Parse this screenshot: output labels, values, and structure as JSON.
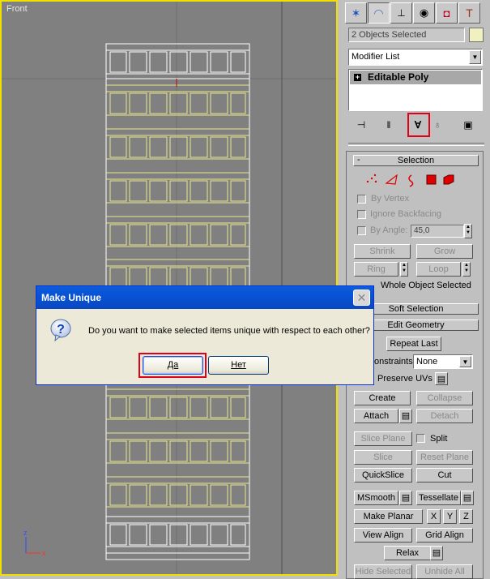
{
  "viewport": {
    "label": "Front"
  },
  "panel": {
    "tabs": [
      "create-icon",
      "modify-icon",
      "hierarchy-icon",
      "motion-icon",
      "display-icon",
      "utilities-icon"
    ],
    "selection_name": "2 Objects Selected",
    "modifier_list": "Modifier List",
    "stack_item": "Editable Poly",
    "selection_rollout": {
      "title": "Selection",
      "by_vertex": "By Vertex",
      "ignore_backfacing": "Ignore Backfacing",
      "by_angle": "By Angle:",
      "angle_value": "45,0",
      "shrink": "Shrink",
      "grow": "Grow",
      "ring": "Ring",
      "loop": "Loop",
      "whole_object": "Whole Object Selected"
    },
    "soft_selection": "Soft Selection",
    "edit_geometry": {
      "title": "Edit Geometry",
      "repeat_last": "Repeat Last",
      "constraints": "onstraints:",
      "constraints_value": "None",
      "preserve_uvs": "Preserve UVs",
      "create": "Create",
      "collapse": "Collapse",
      "attach": "Attach",
      "detach": "Detach",
      "slice_plane": "Slice Plane",
      "split": "Split",
      "slice": "Slice",
      "reset_plane": "Reset Plane",
      "quickslice": "QuickSlice",
      "cut": "Cut",
      "msmooth": "MSmooth",
      "tessellate": "Tessellate",
      "make_planar": "Make Planar",
      "x": "X",
      "y": "Y",
      "z": "Z",
      "view_align": "View Align",
      "grid_align": "Grid Align",
      "relax": "Relax",
      "hide_selected": "Hide Selected",
      "unhide_all": "Unhide All"
    }
  },
  "dialog": {
    "title": "Make Unique",
    "message": "Do you want to make selected items unique with respect to each other?",
    "yes": "Да",
    "no": "Нет"
  },
  "colors": {
    "viewport_border": "#f0e000",
    "highlight": "#e0001a",
    "xp_title": "#0853d5"
  }
}
